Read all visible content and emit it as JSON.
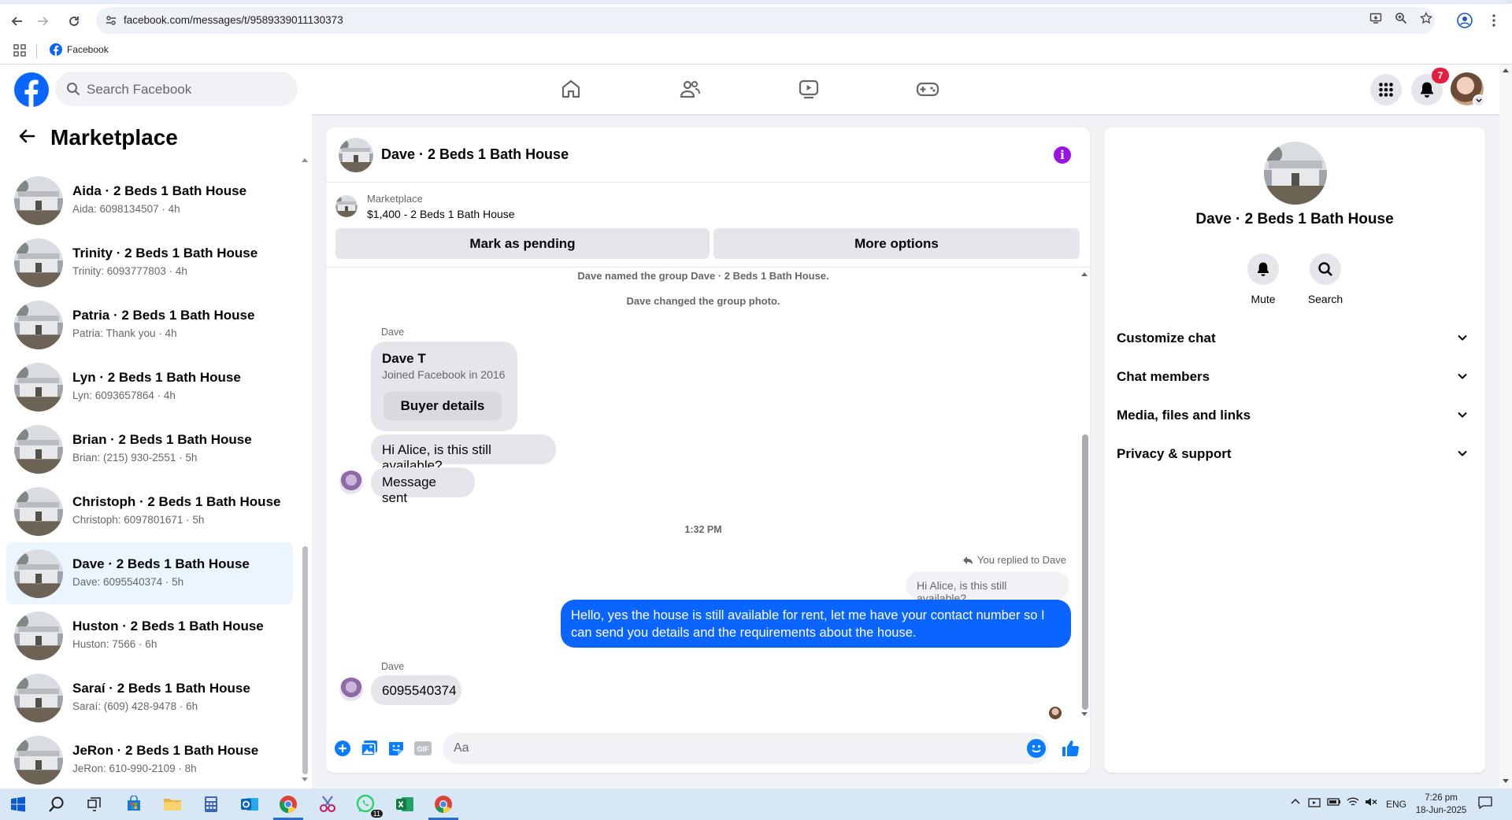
{
  "browser": {
    "url": "facebook.com/messages/t/9589339011130373",
    "bookmark_label": "Facebook"
  },
  "fb": {
    "search_placeholder": "Search Facebook",
    "notifications_count": "7"
  },
  "sidebar": {
    "title": "Marketplace",
    "conversations": [
      {
        "name": "Aida · 2 Beds 1 Bath House",
        "preview": "Aida: 6098134507 · 4h"
      },
      {
        "name": "Trinity · 2 Beds 1 Bath House",
        "preview": "Trinity: 6093777803 · 4h"
      },
      {
        "name": "Patria · 2 Beds 1 Bath House",
        "preview": "Patria: Thank you · 4h"
      },
      {
        "name": "Lyn · 2 Beds 1 Bath House",
        "preview": "Lyn: 6093657864 · 4h"
      },
      {
        "name": "Brian · 2 Beds 1 Bath House",
        "preview": "Brian: (215) 930-2551 · 5h"
      },
      {
        "name": "Christoph · 2 Beds 1 Bath House",
        "preview": "Christoph: 6097801671 · 5h"
      },
      {
        "name": "Dave · 2 Beds 1 Bath House",
        "preview": "Dave: 6095540374 · 5h",
        "active": true
      },
      {
        "name": "Huston · 2 Beds 1 Bath House",
        "preview": "Huston: 7566 · 6h"
      },
      {
        "name": "Saraí · 2 Beds 1 Bath House",
        "preview": "Saraí: (609) 428-9478 · 6h"
      },
      {
        "name": "JeRon · 2 Beds 1 Bath House",
        "preview": "JeRon: 610-990-2109 · 8h"
      }
    ]
  },
  "chat": {
    "title": "Dave · 2 Beds 1 Bath House",
    "listing_source": "Marketplace",
    "listing_title": "$1,400 - 2 Beds 1 Bath House",
    "mark_pending_label": "Mark as pending",
    "more_options_label": "More options",
    "system_1": "Dave named the group Dave · 2 Beds 1 Bath House.",
    "system_2": "Dave changed the group photo.",
    "sender_1": "Dave",
    "card_name": "Dave T",
    "card_sub": "Joined Facebook in 2016",
    "card_button": "Buyer details",
    "msg_1": "Hi Alice, is this still available?",
    "msg_2": "Message sent",
    "timestamp": "1:32 PM",
    "reply_note": "You replied to Dave",
    "quoted": "Hi Alice, is this still available?",
    "out_line_1": "Hello, yes the house is still available for rent, let me have your contact number so I",
    "out_line_2": "can send you details and the requirements about the house.",
    "sender_2": "Dave",
    "msg_3": "6095540374",
    "composer_placeholder": "Aa"
  },
  "right_panel": {
    "name": "Dave · 2 Beds 1 Bath House",
    "mute_label": "Mute",
    "search_label": "Search",
    "sections": [
      "Customize chat",
      "Chat members",
      "Media, files and links",
      "Privacy & support"
    ]
  },
  "taskbar": {
    "language": "ENG",
    "time": "7:26 pm",
    "date": "18-Jun-2025",
    "whatsapp_badge": "11"
  },
  "colors": {
    "accent": "#0a64ff",
    "fb_blue": "#0866ff",
    "badge_red": "#e41e3f",
    "info_purple": "#9b14e5"
  }
}
